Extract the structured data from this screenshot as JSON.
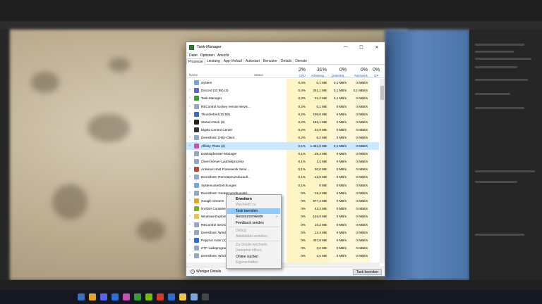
{
  "window": {
    "title": "Task-Manager",
    "controls": {
      "minimize": "—",
      "maximize": "☐",
      "close": "✕"
    }
  },
  "menu": [
    "Datei",
    "Optionen",
    "Ansicht"
  ],
  "tabs": [
    {
      "label": "Prozesse",
      "active": true
    },
    {
      "label": "Leistung"
    },
    {
      "label": "App-Verlauf"
    },
    {
      "label": "Autostart"
    },
    {
      "label": "Benutzer"
    },
    {
      "label": "Details"
    },
    {
      "label": "Dienste"
    }
  ],
  "columns": {
    "name": "Name",
    "status": "Status",
    "cpu": {
      "pct": "2%",
      "label": "CPU"
    },
    "memory": {
      "pct": "31%",
      "label": "Arbeitssp..."
    },
    "disk": {
      "pct": "0%",
      "label": "Datenträ..."
    },
    "network": {
      "pct": "0%",
      "label": "Netzwerk"
    },
    "gpu": {
      "pct": "0%",
      "label": "GP"
    }
  },
  "processes": [
    {
      "name": "System",
      "expand": false,
      "icon": "system-icon",
      "color": "#7aa3d6",
      "cpu": "0,4%",
      "mem": "0,1 MB",
      "disk": "0,1 MB/s",
      "net": "0 MBit/s"
    },
    {
      "name": "Discord (32 Bit) (3)",
      "expand": true,
      "icon": "discord-icon",
      "color": "#5865f2",
      "cpu": "0,4%",
      "mem": "251,1 MB",
      "disk": "0,1 MB/s",
      "net": "0,1 MBit/s"
    },
    {
      "name": "Task-Manager",
      "expand": true,
      "icon": "taskmanager-icon",
      "color": "#3a9a3a",
      "cpu": "0,3%",
      "mem": "31,2 MB",
      "disk": "0,1 MB/s",
      "net": "0 MBit/s"
    },
    {
      "name": "REControl hot key remote servic...",
      "expand": true,
      "icon": "service-icon",
      "color": "#8fa8c8",
      "cpu": "0,2%",
      "mem": "0,1 MB",
      "disk": "0 MB/s",
      "net": "0 MBit/s"
    },
    {
      "name": "Thunderbird (32 Bit)",
      "expand": true,
      "icon": "thunderbird-icon",
      "color": "#2d6fd6",
      "cpu": "0,2%",
      "mem": "196,6 MB",
      "disk": "0 MB/s",
      "net": "0 MBit/s"
    },
    {
      "name": "Stream Deck (8)",
      "expand": true,
      "icon": "streamdeck-icon",
      "color": "#222222",
      "cpu": "0,2%",
      "mem": "152,1 MB",
      "disk": "0 MB/s",
      "net": "0 MBit/s"
    },
    {
      "name": "Elgato Control Center",
      "expand": false,
      "icon": "elgato-icon",
      "color": "#333333",
      "cpu": "0,2%",
      "mem": "32,9 MB",
      "disk": "0 MB/s",
      "net": "0 MBit/s"
    },
    {
      "name": "Diensthost: DNS-Client",
      "expand": true,
      "icon": "service-icon",
      "color": "#8fa8c8",
      "cpu": "0,2%",
      "mem": "6,2 MB",
      "disk": "0 MB/s",
      "net": "0 MBit/s"
    },
    {
      "name": "Affinity Photo (2)",
      "expand": true,
      "icon": "affinity-photo-icon",
      "color": "#c94fb3",
      "cpu": "0,1%",
      "mem": "1.454,9 MB",
      "disk": "0,1 MB/s",
      "net": "0 MBit/s",
      "selected": true
    },
    {
      "name": "Desktopfenster-Manager",
      "expand": false,
      "icon": "dwm-icon",
      "color": "#8fa8c8",
      "cpu": "0,1%",
      "mem": "35,4 MB",
      "disk": "0 MB/s",
      "net": "0 MBit/s"
    },
    {
      "name": "Client-Server-Laufzeitprozess",
      "expand": false,
      "icon": "csrss-icon",
      "color": "#8fa8c8",
      "cpu": "0,1%",
      "mem": "1,4 MB",
      "disk": "0 MB/s",
      "net": "0 MBit/s"
    },
    {
      "name": "Antivirus Host Framework Servi...",
      "expand": true,
      "icon": "antivirus-icon",
      "color": "#d83b2a",
      "cpu": "0,1%",
      "mem": "30,0 MB",
      "disk": "0 MB/s",
      "net": "0 MBit/s"
    },
    {
      "name": "Diensthost: Remoteprozeduraufr...",
      "expand": true,
      "icon": "service-icon",
      "color": "#8fa8c8",
      "cpu": "0,1%",
      "mem": "12,6 MB",
      "disk": "0 MB/s",
      "net": "0 MBit/s"
    },
    {
      "name": "Systemunterbrechungen",
      "expand": false,
      "icon": "system-icon",
      "color": "#7aa3d6",
      "cpu": "0,1%",
      "mem": "0 MB",
      "disk": "0 MB/s",
      "net": "0 MBit/s"
    },
    {
      "name": "Diensthost: Gerätezuordnungsd...",
      "expand": true,
      "icon": "service-icon",
      "color": "#8fa8c8",
      "cpu": "0%",
      "mem": "15,2 MB",
      "disk": "0 MB/s",
      "net": "0 MBit/s"
    },
    {
      "name": "Google Chrome",
      "expand": true,
      "icon": "chrome-icon",
      "color": "#e2a524",
      "cpu": "0%",
      "mem": "977,4 MB",
      "disk": "0 MB/s",
      "net": "0 MBit/s"
    },
    {
      "name": "NVIDIA Container",
      "expand": false,
      "icon": "nvidia-icon",
      "color": "#76b900",
      "cpu": "0%",
      "mem": "43,3 MB",
      "disk": "0 MB/s",
      "net": "0 MBit/s"
    },
    {
      "name": "Windows-Explorer",
      "expand": true,
      "icon": "explorer-icon",
      "color": "#f0c34a",
      "cpu": "0%",
      "mem": "146,9 MB",
      "disk": "0 MB/s",
      "net": "0 MBit/s"
    },
    {
      "name": "REControl Service",
      "expand": true,
      "icon": "service-icon",
      "color": "#8fa8c8",
      "cpu": "0%",
      "mem": "10,2 MB",
      "disk": "0 MB/s",
      "net": "0 MBit/s"
    },
    {
      "name": "Diensthost: Windows",
      "expand": true,
      "icon": "service-icon",
      "color": "#8fa8c8",
      "cpu": "0%",
      "mem": "12,4 MB",
      "disk": "0 MB/s",
      "net": "0 MBit/s"
    },
    {
      "name": "Papyrus Autor (2)",
      "expand": true,
      "icon": "papyrus-icon",
      "color": "#2f6bd1",
      "cpu": "0%",
      "mem": "457,8 MB",
      "disk": "0 MB/s",
      "net": "0 MBit/s"
    },
    {
      "name": "CTF-Ladeprogramm",
      "expand": false,
      "icon": "ctf-icon",
      "color": "#8fa8c8",
      "cpu": "0%",
      "mem": "3,6 MB",
      "disk": "0 MB/s",
      "net": "0 MBit/s"
    },
    {
      "name": "Diensthost: Windows",
      "expand": true,
      "icon": "service-icon",
      "color": "#8fa8c8",
      "cpu": "0%",
      "mem": "3,0 MB",
      "disk": "0 MB/s",
      "net": "0 MBit/s"
    }
  ],
  "context_menu": [
    {
      "label": "Erweitern",
      "bold": true
    },
    {
      "label": "Wechseln zu",
      "disabled": true
    },
    {
      "label": "Task beenden",
      "highlighted": true
    },
    {
      "label": "Ressourcenwerte",
      "submenu": true
    },
    {
      "label": "Feedback senden"
    },
    {
      "separator": true
    },
    {
      "label": "Debug",
      "disabled": true
    },
    {
      "label": "Abbilddatei erstellen",
      "disabled": true
    },
    {
      "separator": true
    },
    {
      "label": "Zu Details wechseln",
      "disabled": true
    },
    {
      "label": "Dateipfad öffnen",
      "disabled": true
    },
    {
      "label": "Online suchen"
    },
    {
      "label": "Eigenschaften",
      "disabled": true
    }
  ],
  "footer": {
    "less_details": "Weniger Details",
    "end_task": "Task beenden"
  },
  "colors": {
    "heat_strong": "#fff4c4",
    "heat_soft": "#fff8d8",
    "selection": "#cce8ff",
    "menu_highlight": "#91c9f7"
  }
}
